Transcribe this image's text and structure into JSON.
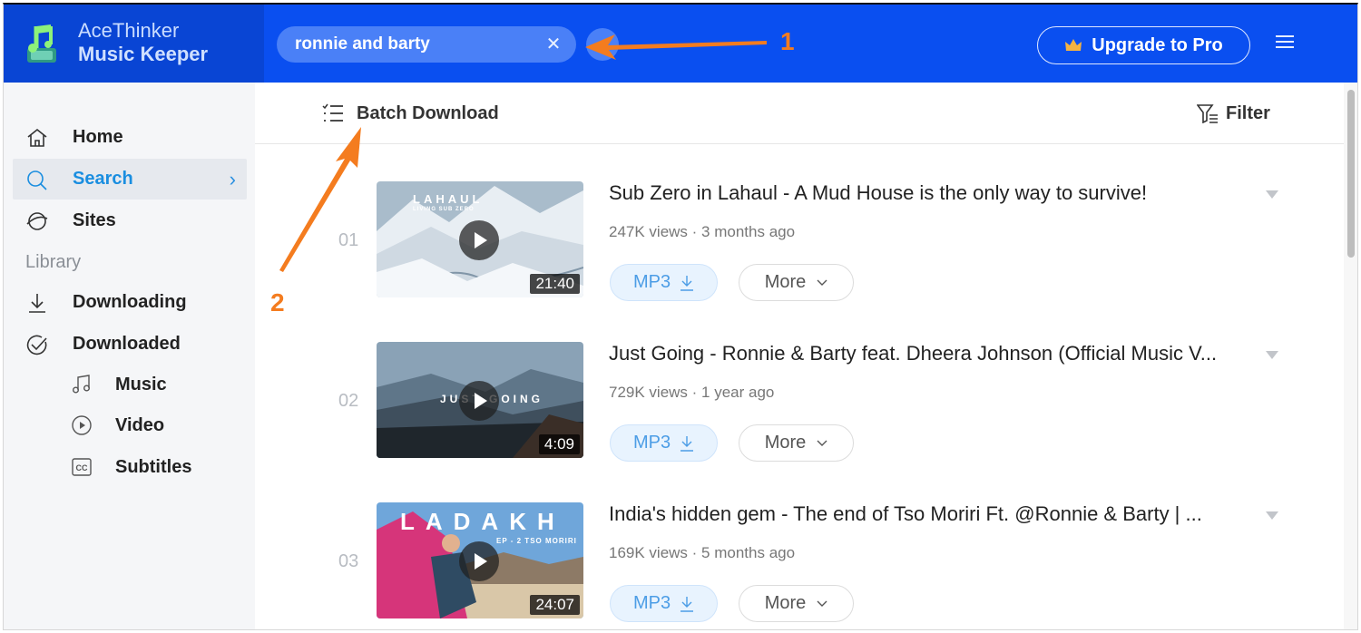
{
  "app": {
    "brand_line1": "AceThinker",
    "brand_line2": "Music Keeper"
  },
  "search": {
    "query": "ronnie and barty",
    "clear_icon": "close-icon"
  },
  "header": {
    "upgrade_label": "Upgrade to Pro",
    "upgrade_icon": "crown-icon",
    "menu_icon": "hamburger-menu-icon"
  },
  "sidebar": {
    "items": [
      {
        "label": "Home",
        "icon": "home-icon"
      },
      {
        "label": "Search",
        "icon": "search-icon",
        "active": true
      },
      {
        "label": "Sites",
        "icon": "globe-icon"
      }
    ],
    "library_label": "Library",
    "library_items": [
      {
        "label": "Downloading",
        "icon": "download-icon"
      },
      {
        "label": "Downloaded",
        "icon": "check-circle-icon"
      }
    ],
    "downloaded_sub": [
      {
        "label": "Music",
        "icon": "music-note-icon"
      },
      {
        "label": "Video",
        "icon": "play-circle-icon"
      },
      {
        "label": "Subtitles",
        "icon": "cc-icon"
      }
    ]
  },
  "toolbar": {
    "batch_label": "Batch Download",
    "filter_label": "Filter"
  },
  "results": [
    {
      "num": "01",
      "title": "Sub Zero in Lahaul - A Mud House is the only way to survive!",
      "meta": "247K views · 3 months ago",
      "duration": "21:40",
      "thumb_text": "LAHAUL",
      "thumb_subtext": "LIVING SUB ZERO",
      "mp3_label": "MP3",
      "more_label": "More"
    },
    {
      "num": "02",
      "title": "Just Going - Ronnie & Barty feat. Dheera Johnson (Official Music V...",
      "meta": "729K views · 1 year ago",
      "duration": "4:09",
      "thumb_text": "JUST GOING",
      "thumb_subtext": "",
      "mp3_label": "MP3",
      "more_label": "More"
    },
    {
      "num": "03",
      "title": "India's hidden gem - The end of Tso Moriri Ft. @Ronnie & Barty | ...",
      "meta": "169K views · 5 months ago",
      "duration": "24:07",
      "thumb_text": "LADAKH",
      "thumb_subtext": "EP - 2 TSO MORIRI",
      "mp3_label": "MP3",
      "more_label": "More"
    }
  ],
  "annotations": {
    "marker1": "1",
    "marker2": "2",
    "color": "#f47c1f"
  },
  "colors": {
    "header": "#0a4ff0",
    "accent": "#1a8ee0"
  }
}
